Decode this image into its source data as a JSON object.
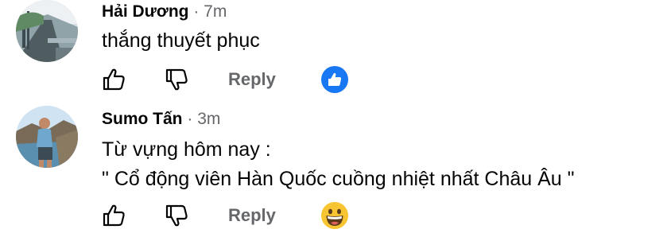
{
  "comments": [
    {
      "author": "Hải Dương",
      "separator": "·",
      "time": "7m",
      "lines": [
        "thắng thuyết phục"
      ],
      "reply_label": "Reply",
      "reaction": "like-reaction-icon"
    },
    {
      "author": "Sumo Tấn",
      "separator": "·",
      "time": "3m",
      "lines": [
        "Từ vựng hôm nay :",
        "\" Cổ động viên Hàn Quốc cuồng nhiệt nhất Châu Âu \""
      ],
      "reply_label": "Reply",
      "reaction": "grinning-face-reaction-icon"
    }
  ],
  "colors": {
    "text_primary": "#050505",
    "text_secondary": "#65676b",
    "like_blue": "#1877f2",
    "emoji_yellow": "#f7c531"
  }
}
